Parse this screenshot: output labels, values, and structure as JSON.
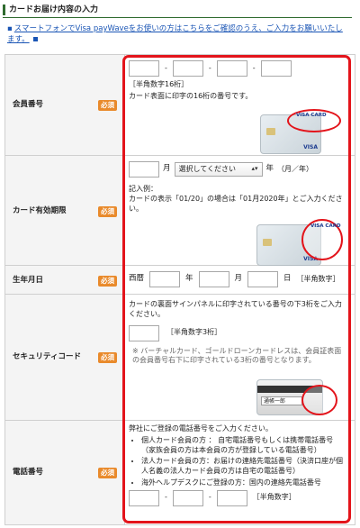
{
  "section": {
    "title": "カードお届け内容の入力"
  },
  "notice": {
    "text": "スマートフォンでVisa payWaveをお使いの方はこちらをご確認のうえ、ご入力をお願いいたします。"
  },
  "card_number": {
    "label": "会員番号",
    "required": "必須",
    "hint": "［半角数字16桁］",
    "desc": "カード表面に印字の16桁の番号です。",
    "dash": "-"
  },
  "expiry": {
    "label": "カード有効期限",
    "required": "必須",
    "month_unit": "月",
    "select_value": "選択してください",
    "year_unit": "年",
    "format": "（月／年）",
    "example_title": "記入例：",
    "example_text": "カードの表示「01/20」の場合は「01月2020年」とご入力ください。"
  },
  "birthdate": {
    "label": "生年月日",
    "required": "必須",
    "era": "西暦",
    "year": "年",
    "month": "月",
    "day": "日",
    "hint": "［半角数字］"
  },
  "security": {
    "label": "セキュリティコード",
    "required": "必須",
    "desc": "カードの裏面サインパネルに印字されている番号の下3桁をご入力ください。",
    "hint": "［半角数字3桁］",
    "note": "※ バーチャルカード、ゴールドローンカードレスは、会員証表面の会員番号右下に印字されている3桁の番号となります。",
    "signature": "通帳一郎"
  },
  "phone": {
    "label": "電話番号",
    "required": "必須",
    "desc": "弊社にご登録の電話番号をご入力ください。",
    "items": [
      "個人カード会員の方 ： 自宅電話番号もしくは携帯電話番号（家族会員の方は本会員の方が登録している電話番号）",
      "法人カード会員の方：お届けの連絡先電話番号（決済口座が個人名義の法人カード会員の方は自宅の電話番号）",
      "海外ヘルプデスクにご登録の方：国内の連絡先電話番号"
    ],
    "hint": "［半角数字］",
    "dash": "-"
  },
  "card_brand": "VISA",
  "card_image_label": "VISA CARD"
}
